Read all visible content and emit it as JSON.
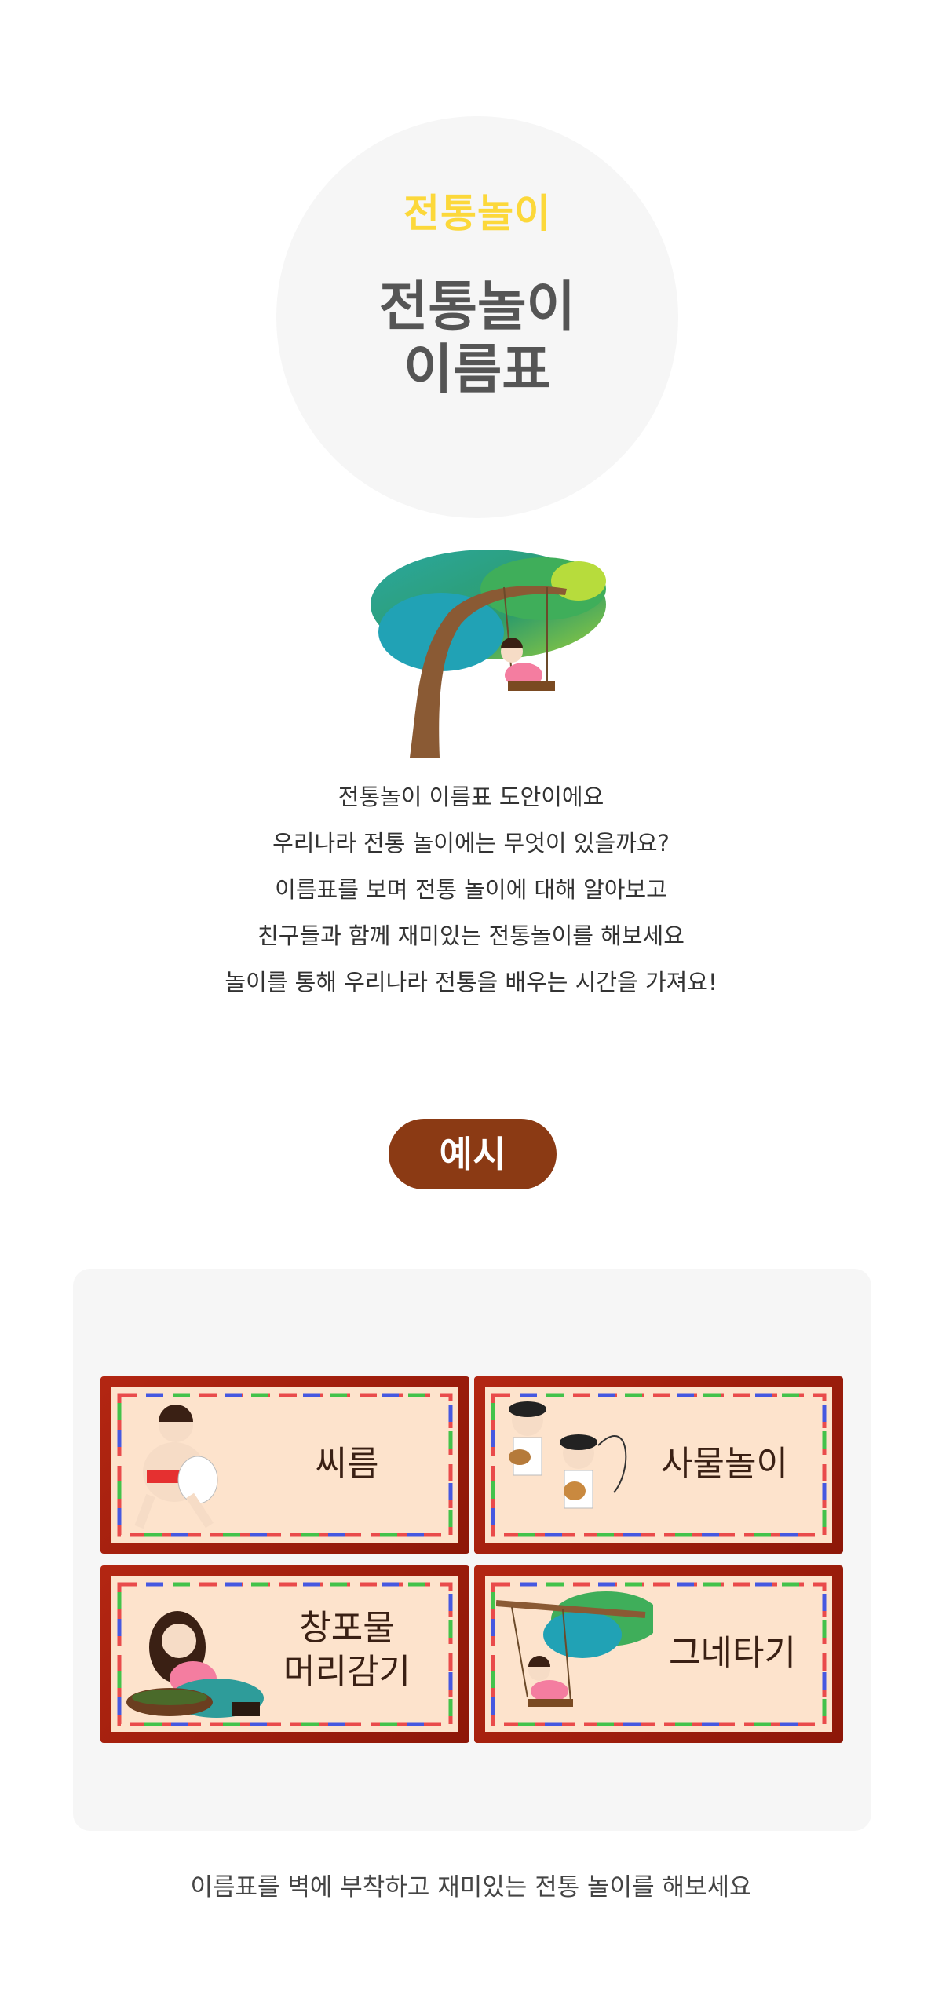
{
  "hero": {
    "subtitle": "전통놀이",
    "title_line1": "전통놀이",
    "title_line2": "이름표"
  },
  "intro": {
    "lines": [
      "전통놀이 이름표 도안이에요",
      "우리나라 전통 놀이에는 무엇이 있을까요?",
      "이름표를 보며 전통 놀이에 대해 알아보고",
      "친구들과 함께 재미있는 전통놀이를 해보세요",
      "놀이를 통해 우리나라 전통을 배우는 시간을 가져요!"
    ]
  },
  "example": {
    "label": "예시"
  },
  "cards": [
    {
      "label": "씨름",
      "art": "ssireum-wrestlers-illustration"
    },
    {
      "label": "사물놀이",
      "art": "samulnori-drummers-illustration"
    },
    {
      "label_line1": "창포물",
      "label_line2": "머리감기",
      "art": "hair-washing-girl-illustration"
    },
    {
      "label": "그네타기",
      "art": "swing-under-tree-illustration"
    }
  ],
  "footer": {
    "text": "이름표를 벽에 부착하고 재미있는 전통 놀이를 해보세요"
  },
  "colors": {
    "accent_yellow": "#fcd83a",
    "pill_brown": "#8b3a14",
    "card_red": "#a82010",
    "card_bg": "#fde3cc"
  }
}
